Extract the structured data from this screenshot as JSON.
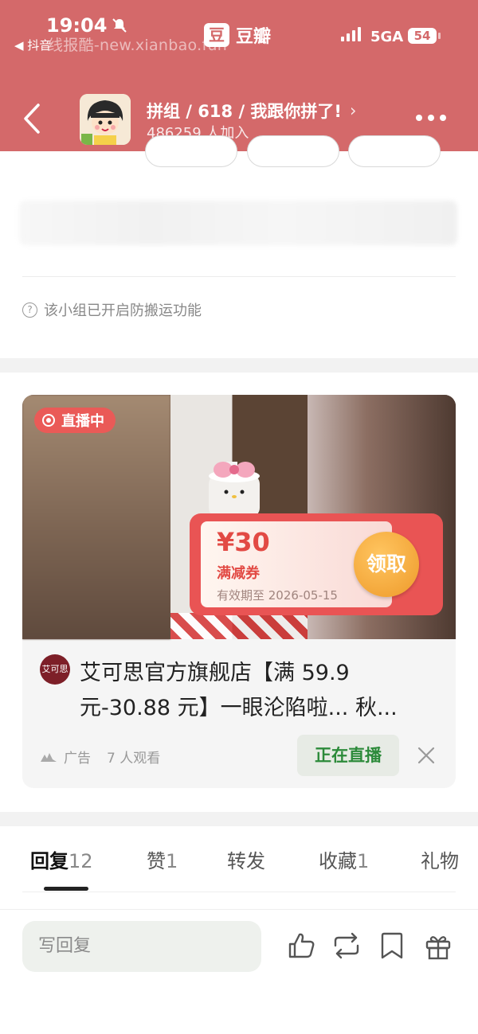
{
  "status_bar": {
    "time": "19:04",
    "back_app": "◀ 抖音",
    "watermark": "线报酷-new.xianbao.fun",
    "brand_icon": "豆",
    "brand": "豆瓣",
    "network": "5GA",
    "battery": "54"
  },
  "header": {
    "group_title": "拼组 / 618 / 我跟你拼了!",
    "member_count": "486259 人加入",
    "chevron": "›"
  },
  "notice": {
    "icon_glyph": "?",
    "text": "该小组已开启防搬运功能"
  },
  "ad": {
    "live_badge": "直播中",
    "coupon": {
      "amount": "¥30",
      "type": "满减券",
      "expiry": "有效期至 2026-05-15",
      "claim": "领取"
    },
    "shop_logo_text": "艾可思",
    "title": "艾可思官方旗舰店【满 59.9 元-30.88 元】一眼沦陷啦... 秋...",
    "label": "广告",
    "viewers": "7 人观看",
    "live_button": "正在直播"
  },
  "tabs": [
    {
      "label": "回复",
      "count": "12"
    },
    {
      "label": "赞",
      "count": "1"
    },
    {
      "label": "转发",
      "count": ""
    },
    {
      "label": "收藏",
      "count": "1"
    },
    {
      "label": "礼物",
      "count": ""
    }
  ],
  "bottom": {
    "reply_placeholder": "写回复"
  },
  "colors": {
    "header_bg": "#d4696a",
    "accent_red": "#e95454",
    "live_green": "#2c8a3a"
  }
}
